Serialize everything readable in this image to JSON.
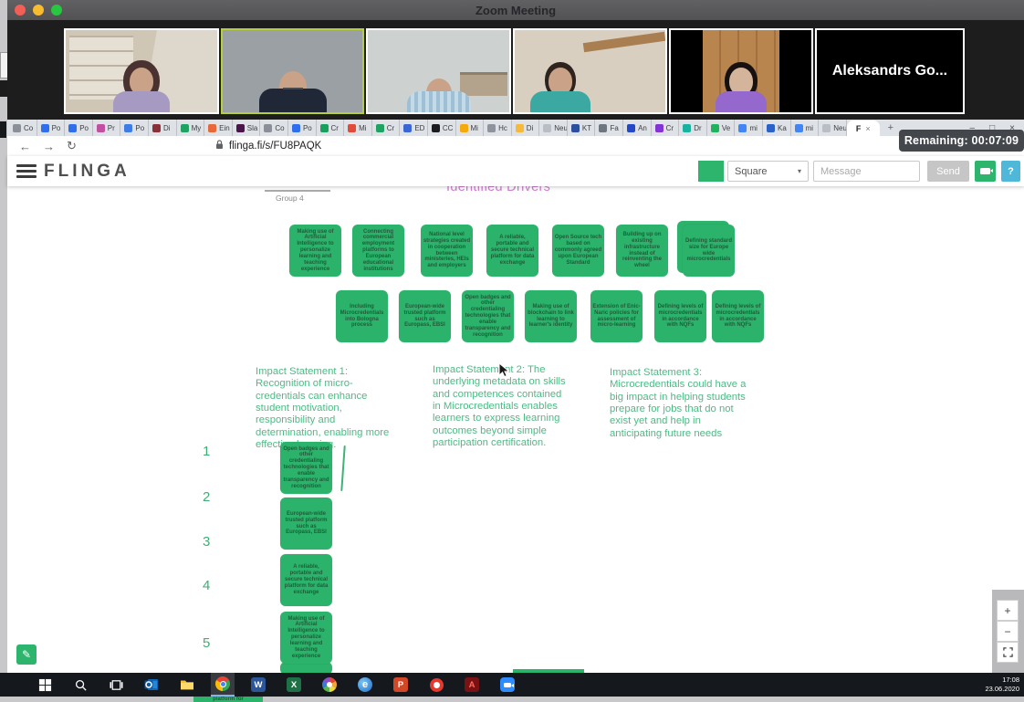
{
  "window": {
    "title": "Zoom Meeting"
  },
  "participants": {
    "name_tile_label": "Aleksandrs Go..."
  },
  "browser": {
    "tabs": [
      {
        "label": "Co",
        "color": "#8a8f98"
      },
      {
        "label": "Po",
        "color": "#2f6fed"
      },
      {
        "label": "Po",
        "color": "#2f6fed"
      },
      {
        "label": "Pr",
        "color": "#c34fa0"
      },
      {
        "label": "Po",
        "color": "#3e7de8"
      },
      {
        "label": "Di",
        "color": "#8a3039"
      },
      {
        "label": "My",
        "color": "#1ea362"
      },
      {
        "label": "Ein",
        "color": "#e8683a"
      },
      {
        "label": "Sla",
        "color": "#4a154b"
      },
      {
        "label": "Co",
        "color": "#8a8f98"
      },
      {
        "label": "Po",
        "color": "#2f6fed"
      },
      {
        "label": "Cr",
        "color": "#18a05e"
      },
      {
        "label": "Mi",
        "color": "#e04b3a"
      },
      {
        "label": "Cr",
        "color": "#1ea362"
      },
      {
        "label": "ED",
        "color": "#3b67d6"
      },
      {
        "label": "CC",
        "color": "#1c1c1e"
      },
      {
        "label": "Mi",
        "color": "#f6a90b"
      },
      {
        "label": "Hc",
        "color": "#8f949c"
      },
      {
        "label": "Di",
        "color": "#f5b93c"
      },
      {
        "label": "Neuer",
        "color": "#b9bdc4"
      },
      {
        "label": "KT",
        "color": "#2b4f9e"
      },
      {
        "label": "Fa",
        "color": "#6e7680"
      },
      {
        "label": "An",
        "color": "#2448c8"
      },
      {
        "label": "Cr",
        "color": "#8433d6"
      },
      {
        "label": "Dr",
        "color": "#17b3a0"
      },
      {
        "label": "Ve",
        "color": "#21b35c"
      },
      {
        "label": "mi",
        "color": "#4285f4"
      },
      {
        "label": "Ka",
        "color": "#2b62c9"
      },
      {
        "label": "mi",
        "color": "#4285f4"
      },
      {
        "label": "Neuer",
        "color": "#b9bdc4"
      }
    ],
    "active_tab": {
      "label": "F",
      "close": "×"
    },
    "new_tab": "+",
    "window_buttons": {
      "minimize": "–",
      "maximize": "□",
      "close": "×"
    },
    "nav": {
      "back": "←",
      "forward": "→",
      "reload": "↻"
    },
    "url": "flinga.fi/s/FU8PAQK",
    "remaining": "Remaining: 00:07:09"
  },
  "flinga": {
    "logo": "FLINGA",
    "shape_select": "Square",
    "select_caret": "▾",
    "message_placeholder": "Message",
    "send": "Send",
    "help": "?"
  },
  "board": {
    "group_label": "Group 4",
    "title": "Identified Drivers",
    "notes_row1": [
      "Making use of Artificial Intelligence to personalize learning and teaching experience",
      "Connecting commercial employment platforms to European educational institutions",
      "National level strategies created in cooperation between ministeries, HEIs and employers",
      "A reliable, portable and secure technical platform for data exchange",
      "Open Source tech based on commonly agreed upon European Standard",
      "Building up on existing infrastructure instead of reinventing the wheel",
      "Defining standard size for Europe wide microcredentials"
    ],
    "notes_row2": [
      "Including Microcredentials into Bologna process",
      "European-wide trusted platform such as Europass, EBSI",
      "Open badges and other credentialing technologies that enable transparency and recognition",
      "Making use of blockchain to link learning to learner's identity",
      "Extension of Enic-Naric policies for assessment of micro-learning",
      "Defining levels of microcredentials in accordance with NQFs",
      "Defining levels of microcredentials in accordance with NQFs"
    ],
    "impact_statements": [
      "Impact Statement 1: Recognition of micro-credentials can enhance student motivation, responsibility and determination, enabling more effective learning.",
      "Impact Statement 2: The underlying metadata on skills and competences contained in Microcredentials enables learners to express learning outcomes beyond simple participation certification.",
      "Impact Statement 3: Microcredentials could have a big impact in helping students prepare for jobs that do not exist yet and help in anticipating future needs"
    ],
    "ranking_numbers": [
      "1",
      "2",
      "3",
      "4",
      "5"
    ],
    "ranking_notes": [
      "Open badges and other credentialing technologies that enable transparency and recognition",
      "European-wide trusted platform such as Europass, EBSI",
      "A reliable, portable and secure technical platform for data exchange",
      "Making use of Artificial Intelligence to personalize learning and teaching experience"
    ],
    "clipped_note_text": "platform for"
  },
  "zoom_controls": {
    "zoom_in": "+",
    "zoom_out": "−"
  },
  "taskbar": {
    "apps": [
      {
        "name": "start"
      },
      {
        "name": "search"
      },
      {
        "name": "task-view"
      },
      {
        "name": "outlook"
      },
      {
        "name": "file-explorer"
      },
      {
        "name": "chrome",
        "active": true
      },
      {
        "name": "word",
        "letter": "W",
        "color": "#2b579a"
      },
      {
        "name": "excel",
        "letter": "X",
        "color": "#1e7145"
      },
      {
        "name": "color-wheel"
      },
      {
        "name": "edge",
        "letter": "e"
      },
      {
        "name": "powerpoint",
        "letter": "P",
        "color": "#d24726"
      },
      {
        "name": "opera"
      },
      {
        "name": "acrobat",
        "letter": "A",
        "color": "#7a1113",
        "fg": "#ff6a5e"
      },
      {
        "name": "zoom"
      }
    ],
    "clock_time": "17:08",
    "clock_date": "23.06.2020"
  }
}
